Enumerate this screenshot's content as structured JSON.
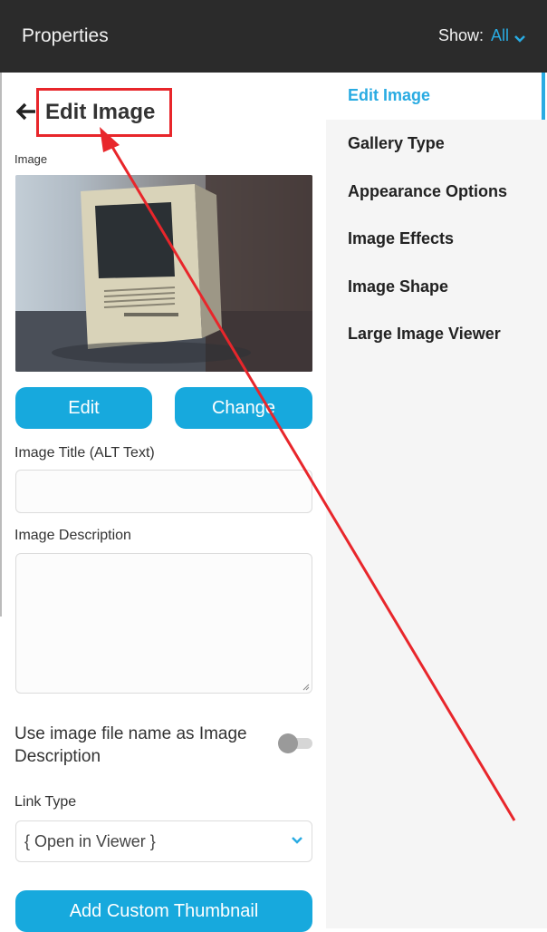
{
  "topbar": {
    "title": "Properties",
    "show_label": "Show:",
    "show_value": "All",
    "show_icon": "chevron-down-icon"
  },
  "editor": {
    "back_icon": "arrow-left-icon",
    "title": "Edit Image",
    "image_label": "Image",
    "edit_button": "Edit",
    "change_button": "Change",
    "title_field_label": "Image Title (ALT Text)",
    "title_field_value": "",
    "description_label": "Image Description",
    "description_value": "",
    "use_filename_label": "Use image file name as Image Description",
    "use_filename_toggle": false,
    "link_type_label": "Link Type",
    "link_type_value": "{ Open in Viewer }",
    "add_thumbnail_button": "Add Custom Thumbnail"
  },
  "sidebar": {
    "items": [
      {
        "label": "Edit Image",
        "active": true
      },
      {
        "label": "Gallery Type",
        "active": false
      },
      {
        "label": "Appearance Options",
        "active": false
      },
      {
        "label": "Image Effects",
        "active": false
      },
      {
        "label": "Image Shape",
        "active": false
      },
      {
        "label": "Large Image Viewer",
        "active": false
      }
    ]
  },
  "colors": {
    "accent": "#29abe2",
    "button": "#17a9dd",
    "topbar": "#2b2b2b",
    "annotation": "#e8262b"
  }
}
